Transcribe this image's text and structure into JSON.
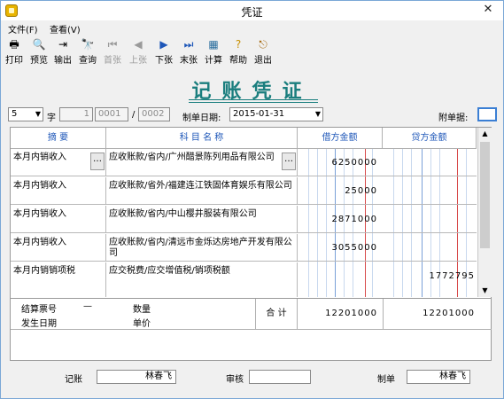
{
  "window": {
    "title": "凭证"
  },
  "menu": [
    "文件(F)",
    "查看(V)"
  ],
  "toolbar": [
    {
      "label": "打印",
      "icon": "printer-icon",
      "enabled": true
    },
    {
      "label": "预览",
      "icon": "preview-icon",
      "enabled": true
    },
    {
      "label": "输出",
      "icon": "export-icon",
      "enabled": true
    },
    {
      "label": "查询",
      "icon": "binoculars-icon",
      "enabled": true
    },
    {
      "label": "首张",
      "icon": "first-icon",
      "enabled": false
    },
    {
      "label": "上张",
      "icon": "prev-icon",
      "enabled": false
    },
    {
      "label": "下张",
      "icon": "next-icon",
      "enabled": true
    },
    {
      "label": "末张",
      "icon": "last-icon",
      "enabled": true
    },
    {
      "label": "计算",
      "icon": "calculator-icon",
      "enabled": true
    },
    {
      "label": "帮助",
      "icon": "help-icon",
      "enabled": true
    },
    {
      "label": "退出",
      "icon": "exit-icon",
      "enabled": true
    }
  ],
  "voucher": {
    "heading": "记账凭证",
    "type_value": "5",
    "char_label": "字",
    "num_a": "1",
    "num_b": "0001",
    "num_sep": "/",
    "num_c": "0002",
    "date_label": "制单日期:",
    "date_value": "2015-01-31",
    "attachments_label": "附单据:",
    "attachments_value": ""
  },
  "grid": {
    "headers": {
      "summary": "摘 要",
      "account": "科 目 名 称",
      "debit": "借方金额",
      "credit": "贷方金额"
    },
    "rows": [
      {
        "summary": "本月内销收入",
        "account": "应收账款/省内/广州醋景陈列用品有限公司",
        "debit": "6250000",
        "credit": ""
      },
      {
        "summary": "本月内销收入",
        "account": "应收账款/省外/福建连江铁固体育娱乐有限公司",
        "debit": "25000",
        "credit": ""
      },
      {
        "summary": "本月内销收入",
        "account": "应收账款/省内/中山樱井服装有限公司",
        "debit": "2871000",
        "credit": ""
      },
      {
        "summary": "本月内销收入",
        "account": "应收账款/省内/清远市金烁达房地产开发有限公司",
        "debit": "3055000",
        "credit": ""
      },
      {
        "summary": "本月内销销项税",
        "account": "应交税费/应交增值税/销项税额",
        "debit": "",
        "credit": "1772795"
      }
    ],
    "footer": {
      "settle_label": "结算票号",
      "settle_value": "—",
      "date_label": "发生日期",
      "qty_label": "数量",
      "price_label": "单价",
      "total_label": "合 计",
      "total_debit": "12201000",
      "total_credit": "12201000"
    }
  },
  "signatures": {
    "bookkeeper_label": "记账",
    "bookkeeper_value": "林春飞",
    "review_label": "审核",
    "review_value": "",
    "maker_label": "制单",
    "maker_value": "林春飞"
  }
}
